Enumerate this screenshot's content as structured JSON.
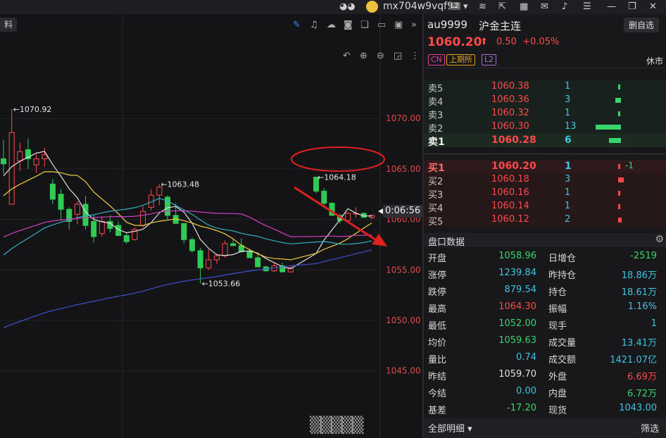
{
  "topbar": {
    "username": "mx704w9vqf9",
    "level_badge": "L2"
  },
  "chart": {
    "left_tab": "料",
    "countdown": "0:06:56",
    "watermark": "▒▒▒▒▒",
    "colors": {
      "up": "#ff4a4a",
      "down": "#2ecc55",
      "ma_white": "#e0e0e0",
      "ma_yellow": "#f0d040",
      "ma_magenta": "#d040c0",
      "ma_cyan": "#30b0c0",
      "ma_blue": "#4050d0",
      "annotation": "#e02020"
    }
  },
  "chart_data": {
    "type": "candlestick",
    "yticks": [
      "1070.00",
      "1065.00",
      "1060.00",
      "1055.00",
      "1050.00",
      "1045.00"
    ],
    "ytick_values": [
      1070,
      1065,
      1060,
      1055,
      1050,
      1045
    ],
    "ylim": [
      1042.4,
      1077.4
    ],
    "annotations": [
      {
        "text": "←1070.92",
        "value": 1070.92,
        "candle": 1
      },
      {
        "text": "←1063.48",
        "value": 1063.48,
        "candle": 19
      },
      {
        "text": "←1053.66",
        "value": 1053.66,
        "candle": 24
      },
      {
        "text": "←1064.18",
        "value": 1064.18,
        "candle": 36
      }
    ],
    "candles": [
      [
        1066.0,
        1067.9,
        1064.5,
        1065.5
      ],
      [
        1061.5,
        1070.92,
        1061.5,
        1068.6
      ],
      [
        1065.8,
        1067.6,
        1064.8,
        1066.7
      ],
      [
        1066.9,
        1068.0,
        1065.0,
        1066.0
      ],
      [
        1065.4,
        1066.4,
        1064.6,
        1066.0
      ],
      [
        1066.0,
        1067.1,
        1065.2,
        1066.4
      ],
      [
        1063.5,
        1064.0,
        1061.5,
        1062.0
      ],
      [
        1062.5,
        1063.0,
        1060.0,
        1061.0
      ],
      [
        1061.0,
        1061.2,
        1059.0,
        1059.8
      ],
      [
        1060.5,
        1061.8,
        1059.5,
        1061.5
      ],
      [
        1061.5,
        1062.3,
        1059.0,
        1059.4
      ],
      [
        1059.8,
        1060.4,
        1057.7,
        1058.3
      ],
      [
        1058.6,
        1060.2,
        1058.3,
        1059.8
      ],
      [
        1059.8,
        1060.4,
        1058.7,
        1059.1
      ],
      [
        1059.4,
        1059.8,
        1058.4,
        1058.4
      ],
      [
        1058.4,
        1058.7,
        1057.6,
        1057.8
      ],
      [
        1058.0,
        1059.2,
        1057.9,
        1059.0
      ],
      [
        1059.4,
        1061.3,
        1059.2,
        1060.8
      ],
      [
        1061.2,
        1063.0,
        1060.9,
        1062.4
      ],
      [
        1062.4,
        1063.48,
        1061.4,
        1063.2
      ],
      [
        1062.2,
        1062.4,
        1059.9,
        1060.4
      ],
      [
        1060.4,
        1061.6,
        1060.2,
        1059.6
      ],
      [
        1059.6,
        1059.6,
        1057.6,
        1058.0
      ],
      [
        1058.0,
        1058.2,
        1056.7,
        1056.9
      ],
      [
        1056.9,
        1057.2,
        1053.66,
        1055.2
      ],
      [
        1055.2,
        1057.0,
        1055.0,
        1056.0
      ],
      [
        1056.0,
        1056.6,
        1055.6,
        1056.4
      ],
      [
        1056.4,
        1057.9,
        1056.2,
        1057.6
      ],
      [
        1057.6,
        1058.1,
        1057.4,
        1057.4
      ],
      [
        1057.4,
        1058.1,
        1056.7,
        1056.8
      ],
      [
        1056.8,
        1057.1,
        1056.2,
        1056.2
      ],
      [
        1056.2,
        1056.5,
        1055.3,
        1055.3
      ],
      [
        1055.3,
        1055.4,
        1054.9,
        1054.9
      ],
      [
        1054.9,
        1055.8,
        1054.8,
        1055.4
      ],
      [
        1055.4,
        1055.7,
        1054.8,
        1054.8
      ],
      [
        1054.8,
        1055.3,
        1054.8,
        1055.2
      ],
      [
        1064.18,
        1064.18,
        1062.6,
        1062.8
      ],
      [
        1062.8,
        1063.1,
        1061.3,
        1061.6
      ],
      [
        1061.6,
        1061.7,
        1060.4,
        1060.4
      ],
      [
        1060.4,
        1060.5,
        1059.6,
        1059.9
      ],
      [
        1059.9,
        1060.7,
        1059.8,
        1060.6
      ],
      [
        1060.6,
        1061.2,
        1060.2,
        1060.6
      ],
      [
        1060.6,
        1060.7,
        1060.2,
        1060.2
      ],
      [
        1060.2,
        1060.5,
        1060.0,
        1060.4
      ]
    ]
  },
  "quote": {
    "code": "au9999",
    "name": "沪金主连",
    "delete_button": "删自选",
    "last_price": "1060.20",
    "change": "0.50",
    "change_pct": "+0.05%",
    "badges": [
      "CN",
      "上期所",
      "L2"
    ],
    "status": "休市",
    "asks": [
      {
        "label": "卖5",
        "price": "1060.38",
        "vol": "1",
        "bar_frac": 0.08
      },
      {
        "label": "卖4",
        "price": "1060.36",
        "vol": "3",
        "bar_frac": 0.23
      },
      {
        "label": "卖3",
        "price": "1060.32",
        "vol": "1",
        "bar_frac": 0.08
      },
      {
        "label": "卖2",
        "price": "1060.30",
        "vol": "13",
        "bar_frac": 1.0
      },
      {
        "label": "卖1",
        "price": "1060.28",
        "vol": "6",
        "bar_frac": 0.46
      }
    ],
    "bids": [
      {
        "label": "买1",
        "price": "1060.20",
        "vol": "1",
        "bar_frac": 0.08,
        "chg": "-1"
      },
      {
        "label": "买2",
        "price": "1060.18",
        "vol": "3",
        "bar_frac": 0.23
      },
      {
        "label": "买3",
        "price": "1060.16",
        "vol": "1",
        "bar_frac": 0.08
      },
      {
        "label": "买4",
        "price": "1060.14",
        "vol": "1",
        "bar_frac": 0.08
      },
      {
        "label": "买5",
        "price": "1060.12",
        "vol": "2",
        "bar_frac": 0.15
      }
    ],
    "stats_title": "盘口数据",
    "stats_left": [
      {
        "k": "开盘",
        "v": "1058.96",
        "c": "#37d56a"
      },
      {
        "k": "涨停",
        "v": "1239.84",
        "c": "#3fc3e0"
      },
      {
        "k": "跌停",
        "v": "879.54",
        "c": "#3fc3e0"
      },
      {
        "k": "最高",
        "v": "1064.30",
        "c": "#ff4a4a"
      },
      {
        "k": "最低",
        "v": "1052.00",
        "c": "#37d56a"
      },
      {
        "k": "均价",
        "v": "1059.63",
        "c": "#37d56a"
      },
      {
        "k": "量比",
        "v": "0.74",
        "c": "#3fc3e0"
      },
      {
        "k": "昨结",
        "v": "1059.70",
        "c": "#e0e0e0"
      },
      {
        "k": "今结",
        "v": "0.00",
        "c": "#3fc3e0"
      },
      {
        "k": "基差",
        "v": "-17.20",
        "c": "#37d56a"
      }
    ],
    "stats_right": [
      {
        "k": "日增仓",
        "v": "-2519",
        "c": "#37d56a"
      },
      {
        "k": "昨持仓",
        "v": "18.86万",
        "c": "#3fc3e0"
      },
      {
        "k": "持仓",
        "v": "18.61万",
        "c": "#3fc3e0"
      },
      {
        "k": "振幅",
        "v": "1.16%",
        "c": "#3fc3e0"
      },
      {
        "k": "现手",
        "v": "1",
        "c": "#3fc3e0"
      },
      {
        "k": "成交量",
        "v": "13.41万",
        "c": "#3fc3e0"
      },
      {
        "k": "成交额",
        "v": "1421.07亿",
        "c": "#3fc3e0"
      },
      {
        "k": "外盘",
        "v": "6.69万",
        "c": "#ff4a4a"
      },
      {
        "k": "内盘",
        "v": "6.72万",
        "c": "#37d56a"
      },
      {
        "k": "现货",
        "v": "1043.00",
        "c": "#3fc3e0"
      }
    ],
    "bottom_left": "全部明细",
    "bottom_right": "筛选"
  }
}
